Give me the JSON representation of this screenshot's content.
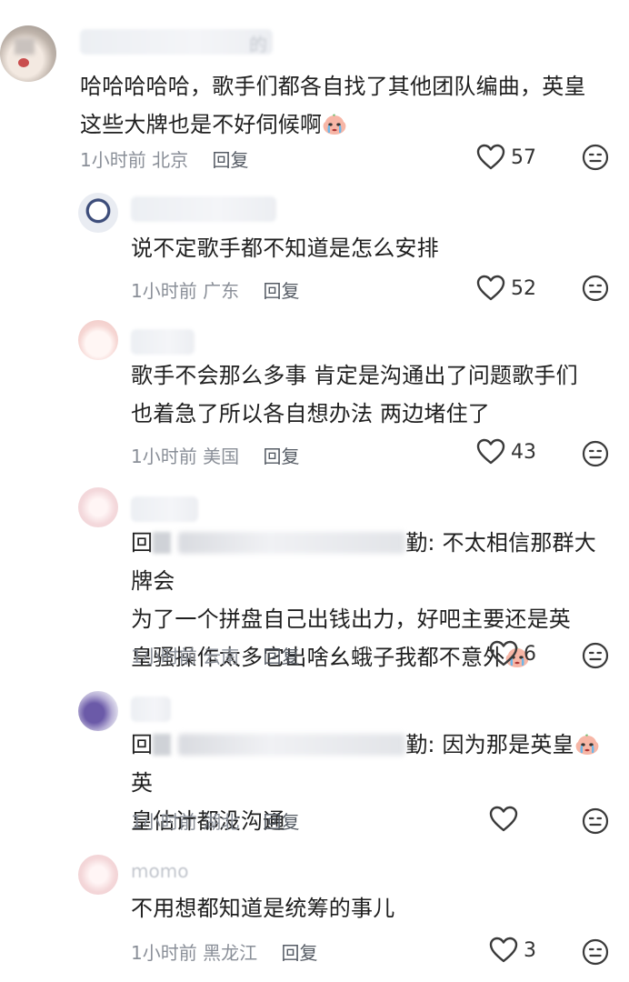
{
  "comments": [
    {
      "text_lines": [
        "哈哈哈哈哈，歌手们都各自找了其他团队编曲，英皇",
        "这些大牌也是不好伺候啊"
      ],
      "time": "1小时前",
      "location": "北京",
      "reply_label": "回复",
      "likes": "57",
      "name_tail": "的"
    },
    {
      "name_hint": "黑蛋小王子",
      "text_lines": [
        "说不定歌手都不知道是怎么安排"
      ],
      "time": "1小时前",
      "location": "广东",
      "reply_label": "回复",
      "likes": "52"
    },
    {
      "text_lines": [
        "歌手不会那么多事 肯定是沟通出了问题歌手们",
        "也着急了所以各自想办法 两边堵住了"
      ],
      "time": "1小时前",
      "location": "美国",
      "reply_label": "回复",
      "likes": "43"
    },
    {
      "reply_prefix": "回",
      "reply_tail": "勤:",
      "text_first": " 不太相信那群大牌会",
      "text_lines": [
        "为了一个拼盘自己出钱出力，好吧主要还是英",
        "皇骚操作太多它出啥幺蛾子我都不意外"
      ],
      "time": "1小时前",
      "location": "云南",
      "reply_label": "回复",
      "likes": "6"
    },
    {
      "reply_prefix": "回",
      "reply_tail": "勤:",
      "text_first": " 因为那是英皇",
      "text_after_emoji": " 英",
      "text_lines": [
        "皇估计都没沟通"
      ],
      "time": "1小时前",
      "location": "湖北",
      "reply_label": "回复",
      "likes": ""
    },
    {
      "name_tail": "momo",
      "text_lines": [
        "不用想都知道是统筹的事儿"
      ],
      "time": "1小时前",
      "location": "黑龙江",
      "reply_label": "回复",
      "likes": "3"
    }
  ],
  "colors": {
    "text": "#1f1f1f",
    "meta": "#8a8f98",
    "icon": "#3a3a3a"
  },
  "icons": {
    "like": "heart-outline-icon",
    "dislike": "neutral-face-icon",
    "emoji": "crying-emoji-icon"
  }
}
